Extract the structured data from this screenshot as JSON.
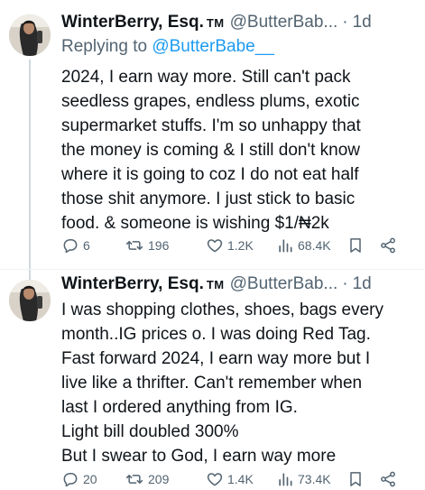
{
  "tweets": [
    {
      "author_name": "WinterBerry, Esq.",
      "author_badge": "TM",
      "handle": "@ButterBab...",
      "separator": "·",
      "time": "1d",
      "replying_prefix": "Replying to",
      "replying_to": "@ButterBabe__",
      "lines": [
        "2024, I earn way more. Still can't pack",
        "seedless grapes, endless plums, exotic",
        "supermarket stuffs. I'm so unhappy that",
        "the money is coming & I still don't know",
        "where it is going to coz I do not eat half",
        "those shit anymore. I just stick to basic",
        "food. & someone is wishing $1/₦2k"
      ],
      "stats": {
        "replies": "6",
        "retweets": "196",
        "likes": "1.2K",
        "views": "68.4K"
      }
    },
    {
      "author_name": "WinterBerry, Esq.",
      "author_badge": "TM",
      "handle": "@ButterBab...",
      "separator": "·",
      "time": "1d",
      "lines": [
        "I was shopping clothes, shoes, bags every",
        "month..IG prices o. I was doing Red Tag.",
        "Fast forward 2024, I earn way more but I",
        "live like a thrifter. Can't remember when",
        "last I ordered anything from IG.",
        "Light bill doubled 300%",
        "But I swear to God, I earn way more"
      ],
      "stats": {
        "replies": "20",
        "retweets": "209",
        "likes": "1.4K",
        "views": "73.4K"
      }
    }
  ],
  "icons": {
    "reply": "reply-icon",
    "retweet": "retweet-icon",
    "like": "like-icon",
    "views": "views-icon",
    "bookmark": "bookmark-icon",
    "share": "share-icon"
  },
  "colors": {
    "text": "#0f1419",
    "secondary": "#536471",
    "link": "#1d9bf0",
    "divider": "#eff3f4"
  }
}
